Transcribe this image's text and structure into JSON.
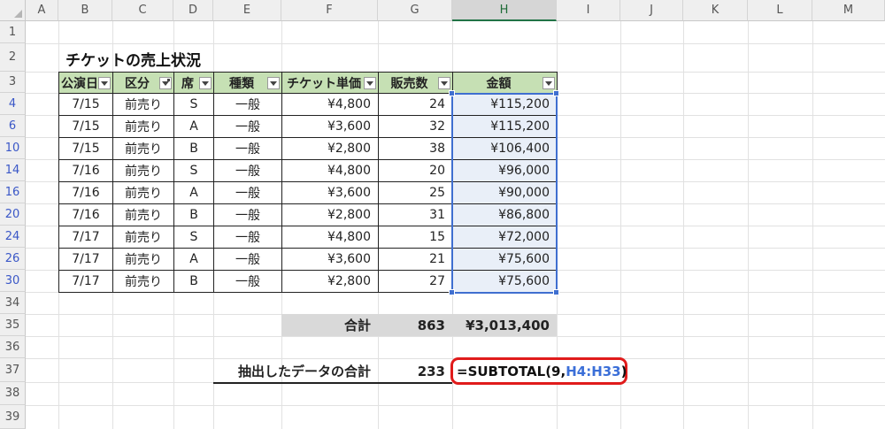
{
  "columns": [
    "A",
    "B",
    "C",
    "D",
    "E",
    "F",
    "G",
    "H",
    "I",
    "J",
    "K",
    "L",
    "M"
  ],
  "selected_column": "H",
  "rows": [
    "1",
    "2",
    "3",
    "4",
    "6",
    "10",
    "14",
    "16",
    "20",
    "24",
    "26",
    "30",
    "34",
    "35",
    "36",
    "37",
    "38",
    "39"
  ],
  "filtered_rows": [
    "4",
    "6",
    "10",
    "14",
    "16",
    "20",
    "24",
    "26",
    "30"
  ],
  "title": "チケットの売上状況",
  "table": {
    "headers": [
      "公演日",
      "区分",
      "席",
      "種類",
      "チケット単価",
      "販売数",
      "金額"
    ],
    "filtered_header_index": 1,
    "rows": [
      [
        "7/15",
        "前売り",
        "S",
        "一般",
        "¥4,800",
        "24",
        "¥115,200"
      ],
      [
        "7/15",
        "前売り",
        "A",
        "一般",
        "¥3,600",
        "32",
        "¥115,200"
      ],
      [
        "7/15",
        "前売り",
        "B",
        "一般",
        "¥2,800",
        "38",
        "¥106,400"
      ],
      [
        "7/16",
        "前売り",
        "S",
        "一般",
        "¥4,800",
        "20",
        "¥96,000"
      ],
      [
        "7/16",
        "前売り",
        "A",
        "一般",
        "¥3,600",
        "25",
        "¥90,000"
      ],
      [
        "7/16",
        "前売り",
        "B",
        "一般",
        "¥2,800",
        "31",
        "¥86,800"
      ],
      [
        "7/17",
        "前売り",
        "S",
        "一般",
        "¥4,800",
        "15",
        "¥72,000"
      ],
      [
        "7/17",
        "前売り",
        "A",
        "一般",
        "¥3,600",
        "21",
        "¥75,600"
      ],
      [
        "7/17",
        "前売り",
        "B",
        "一般",
        "¥2,800",
        "27",
        "¥75,600"
      ]
    ]
  },
  "total": {
    "label": "合計",
    "count": "863",
    "amount": "¥3,013,400"
  },
  "extract": {
    "label": "抽出したデータの合計",
    "count": "233",
    "formula_prefix": "=SUBTOTAL(9,",
    "formula_ref": "H4:H33",
    "formula_suffix": ")"
  },
  "colors": {
    "header_fill": "#c6e0b4",
    "selection": "#3f6fd0",
    "highlight": "#e01b1b"
  }
}
